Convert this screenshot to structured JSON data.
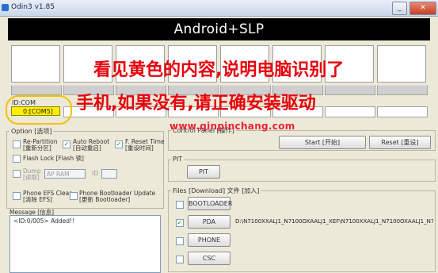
{
  "window": {
    "title": "Odin3 v1.85"
  },
  "banner": {
    "text": "Android+SLP"
  },
  "device": {
    "id_com_label": "ID:COM",
    "com_port": "0:[COM5]"
  },
  "annotation": {
    "line1": "看见黄色的内容,说明电脑识别了",
    "line2": "手机,如果没有,请正确安装驱动"
  },
  "watermark": "www.qinpinchang.com",
  "option": {
    "title": "Option [选项]",
    "re_partition": "Re-Partition",
    "re_partition_cn": "[重新分区]",
    "auto_reboot": "Auto Reboot",
    "auto_reboot_cn": "[自动重启]",
    "f_reset_time": "F. Reset Time",
    "f_reset_time_cn": "[重设时间]",
    "flash_lock": "Flash Lock [Flash 锁]",
    "dump": "Dump",
    "dump_cn": "[读取]",
    "dump_select": "AP RAM",
    "id_label": "ID",
    "phone_efs_clear": "Phone EFS Clear",
    "phone_efs_clear_cn": "[清除 EFS]",
    "phone_bootloader_update": "Phone Bootloader Update",
    "phone_bootloader_update_cn": "[更新 Bootloader]",
    "auto_reboot_checked": true,
    "f_reset_time_checked": true
  },
  "message": {
    "title": "Message [信息]",
    "text": "<ID:0/005> Added!!"
  },
  "control_panel": {
    "title": "Control Panel [操作]",
    "start": "Start [开始]",
    "reset": "Reset [重设]"
  },
  "pit": {
    "title": "PIT",
    "button": "PIT"
  },
  "files": {
    "title": "Files [Download] 文件 [加入]",
    "rows": [
      {
        "label": "BOOTLOADER",
        "checked": false,
        "path": ""
      },
      {
        "label": "PDA",
        "checked": true,
        "path": "D:\\N7100XXALJ1_N7100OXAALJ1_XEF\\N7100XXALJ1_N7100OXAALJ1_N7100X"
      },
      {
        "label": "PHONE",
        "checked": false,
        "path": ""
      },
      {
        "label": "CSC",
        "checked": false,
        "path": ""
      }
    ]
  },
  "colors": {
    "com_highlight": "#ffee00",
    "annotation_red": "#e8000c",
    "banner_bg": "#000000"
  }
}
